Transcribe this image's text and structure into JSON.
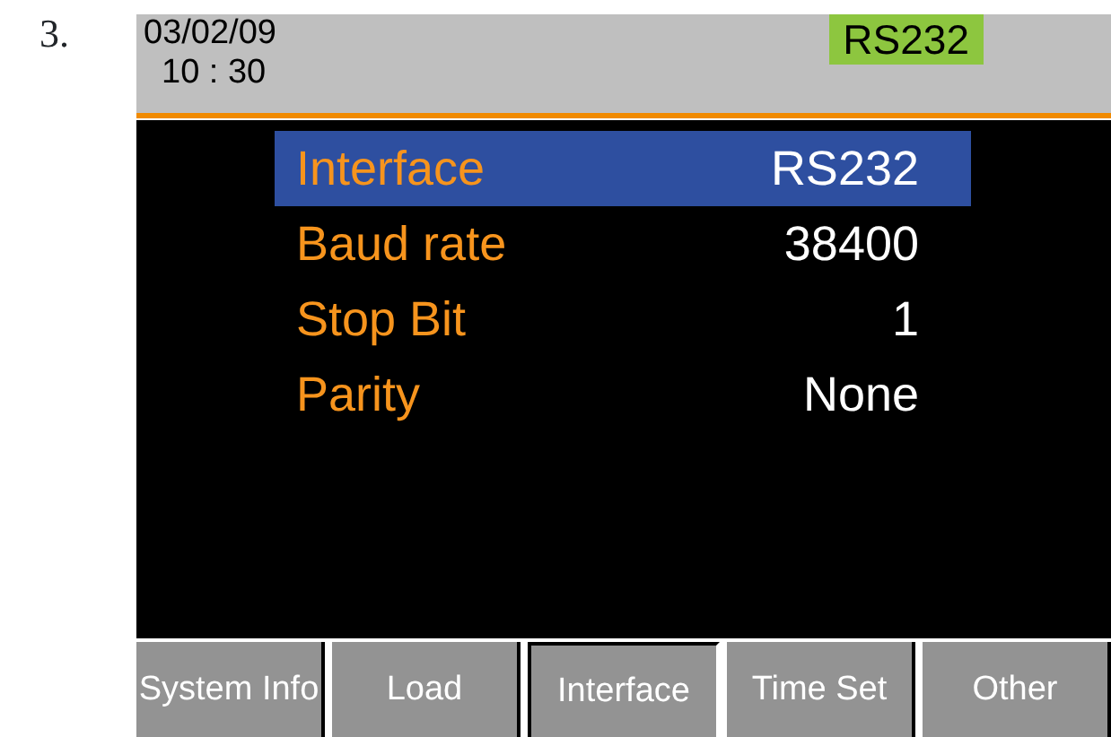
{
  "step": "3.",
  "header": {
    "date": "03/02/09",
    "time": "10 : 30",
    "interface_badge": "RS232"
  },
  "settings": [
    {
      "label": "Interface",
      "value": "RS232",
      "selected": true
    },
    {
      "label": "Baud rate",
      "value": "38400",
      "selected": false
    },
    {
      "label": "Stop Bit",
      "value": "1",
      "selected": false
    },
    {
      "label": "Parity",
      "value": "None",
      "selected": false
    }
  ],
  "softkeys": [
    {
      "label": "System Info",
      "selected": false
    },
    {
      "label": "Load",
      "selected": false
    },
    {
      "label": "Interface",
      "selected": true
    },
    {
      "label": "Time Set",
      "selected": false
    },
    {
      "label": "Other",
      "selected": false
    }
  ]
}
